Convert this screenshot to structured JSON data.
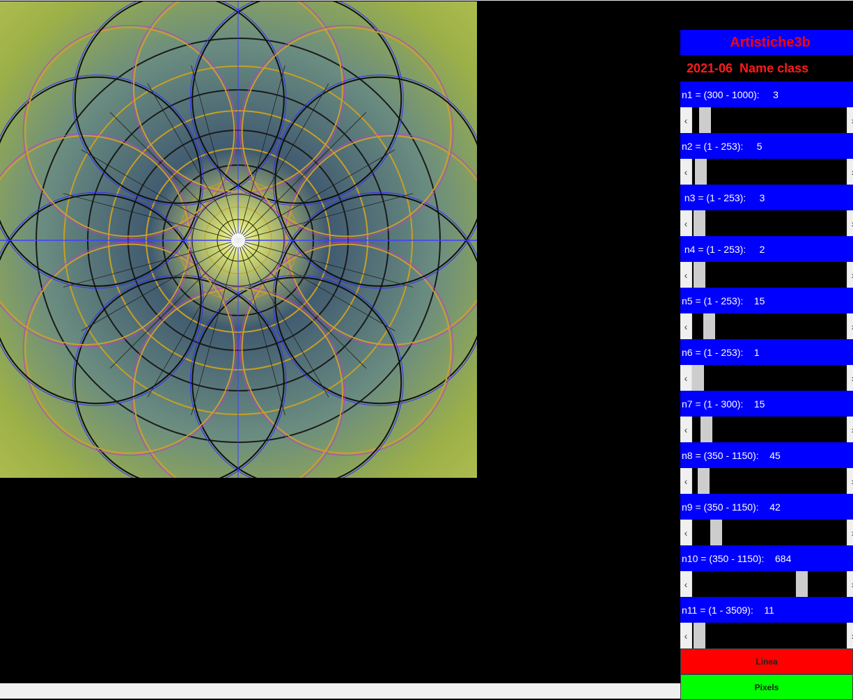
{
  "app": {
    "title": "Artistiche3b",
    "subtitle": "2021-06  Name class"
  },
  "canvas": {
    "description_icon": "fractal-canvas",
    "colors": {
      "base": "#a4b848",
      "ring": "#1a1a1a",
      "line_blue": "#3030ff",
      "line_magenta": "#c040c0",
      "center": "#ffffff"
    }
  },
  "params": [
    {
      "label": "n1 = (300 - 1000):     3",
      "value": 3,
      "min": 300,
      "max": 1000
    },
    {
      "label": "n2 = (1 - 253):     5",
      "value": 5,
      "min": 1,
      "max": 253
    },
    {
      "label": " n3 = (1 - 253):     3",
      "value": 3,
      "min": 1,
      "max": 253
    },
    {
      "label": " n4 = (1 - 253):     2",
      "value": 2,
      "min": 1,
      "max": 253
    },
    {
      "label": "n5 = (1 - 253):    15",
      "value": 15,
      "min": 1,
      "max": 253
    },
    {
      "label": "n6 = (1 - 253):    1",
      "value": 1,
      "min": 1,
      "max": 253
    },
    {
      "label": "n7 = (1 - 300):    15",
      "value": 15,
      "min": 1,
      "max": 300
    },
    {
      "label": "n8 = (350 - 1150):    45",
      "value": 45,
      "min": 350,
      "max": 1150
    },
    {
      "label": "n9 = (350 - 1150):    42",
      "value": 42,
      "min": 350,
      "max": 1150
    },
    {
      "label": "n10 = (350 - 1150):    684",
      "value": 684,
      "min": 350,
      "max": 1150
    },
    {
      "label": "n11 = (1 - 3509):    11",
      "value": 11,
      "min": 1,
      "max": 3509
    }
  ],
  "slider_positions": [
    0.05,
    0.02,
    0.01,
    0.01,
    0.08,
    0.0,
    0.06,
    0.04,
    0.13,
    0.74,
    0.01
  ],
  "buttons": {
    "linea": {
      "label": "Linea",
      "color": "#ff0000"
    },
    "pixels": {
      "label": "Pixels",
      "color": "#00ff00"
    }
  },
  "scroll_arrows": {
    "left": "‹",
    "right": "›"
  }
}
